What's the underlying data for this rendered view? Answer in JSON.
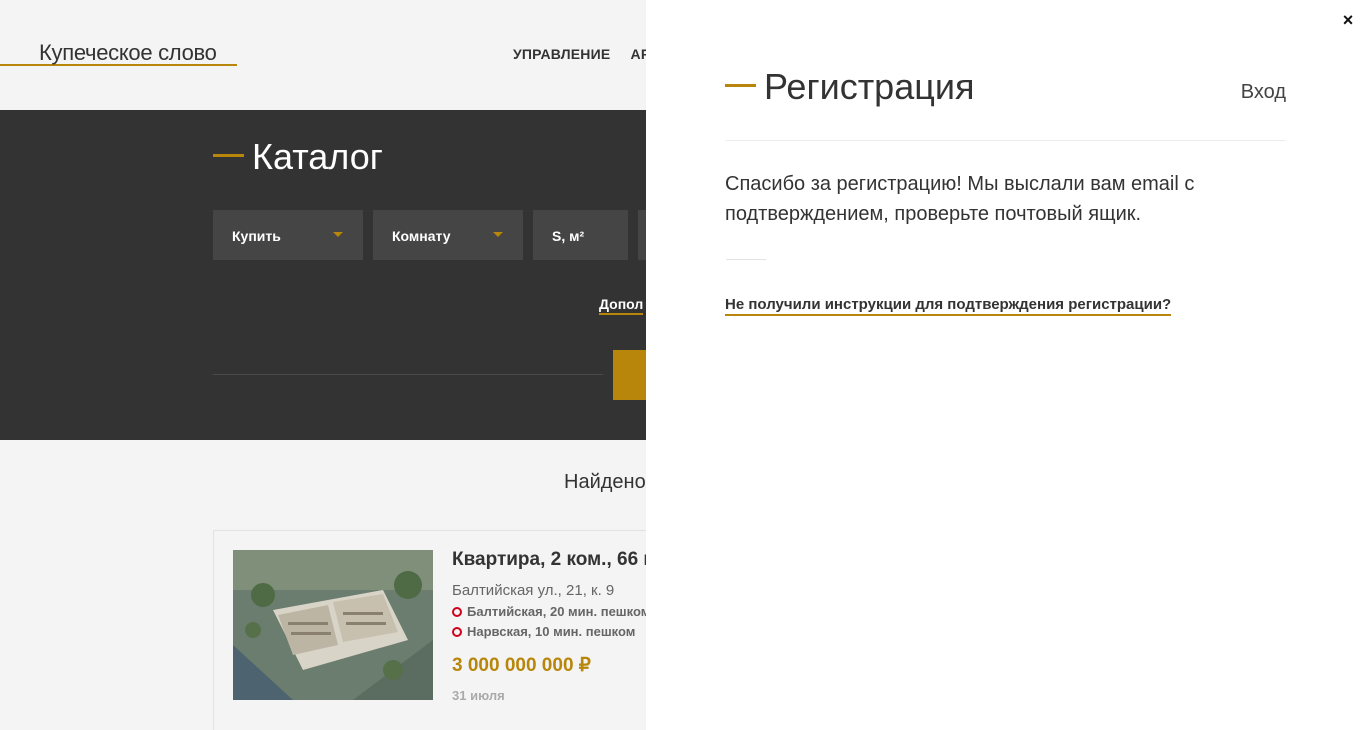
{
  "header": {
    "logo": "Купеческое слово",
    "nav": [
      "УПРАВЛЕНИЕ",
      "АР"
    ]
  },
  "catalog": {
    "title": "Каталог",
    "filters": [
      {
        "label": "Купить",
        "has_dropdown": true
      },
      {
        "label": "Комнату",
        "has_dropdown": true
      },
      {
        "label": "S, м²",
        "has_dropdown": false
      }
    ],
    "more_link": "Допол"
  },
  "results": {
    "found_label": "Найдено",
    "listing": {
      "title": "Квартира, 2 ком., 66 м",
      "address": "Балтийская ул., 21, к. 9",
      "metro": [
        {
          "name": "Балтийская, 20 мин. пешком"
        },
        {
          "name": "Нарвская, 10 мин. пешком"
        }
      ],
      "price": "3 000 000 000 ₽",
      "date": "31 июля"
    }
  },
  "modal": {
    "close_icon": "×",
    "title": "Регистрация",
    "login_link": "Вход",
    "message": "Спасибо за регистрацию! Мы выслали вам email с подтверждением, проверьте почтовый ящик.",
    "resend_link": "Не получили инструкции для подтверждения регистрации?"
  },
  "colors": {
    "accent": "#b8860b",
    "dark": "#333333",
    "metro_red": "#d0021b"
  }
}
